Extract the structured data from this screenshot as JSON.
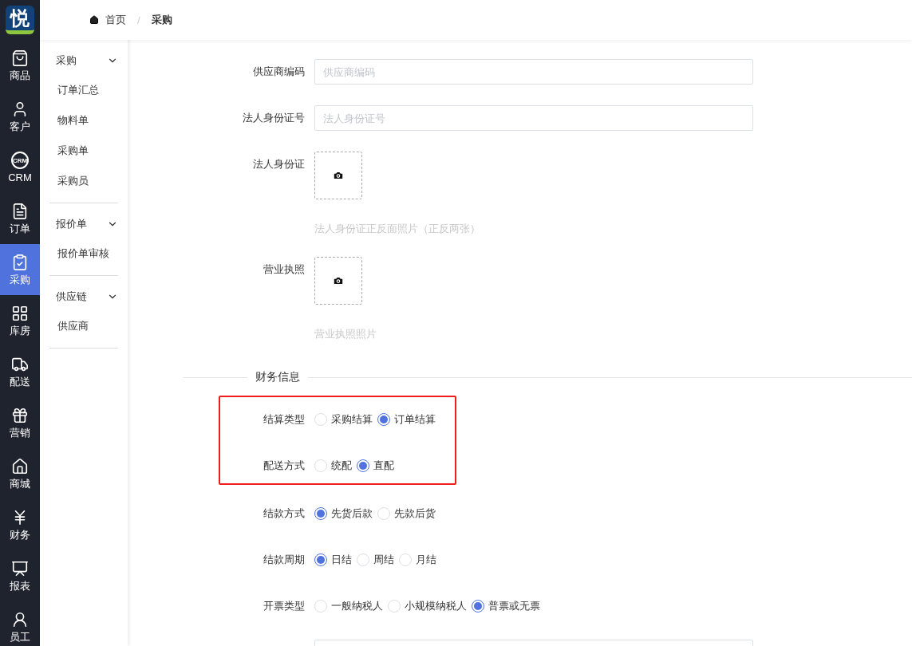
{
  "logo": {
    "text": "悦"
  },
  "rail": [
    {
      "label": "商品",
      "selected": false
    },
    {
      "label": "客户",
      "selected": false
    },
    {
      "label": "CRM",
      "icon_text": "CRM",
      "selected": false
    },
    {
      "label": "订单",
      "selected": false
    },
    {
      "label": "采购",
      "selected": true
    },
    {
      "label": "库房",
      "selected": false
    },
    {
      "label": "配送",
      "selected": false
    },
    {
      "label": "营销",
      "selected": false
    },
    {
      "label": "商城",
      "selected": false
    },
    {
      "label": "财务",
      "selected": false
    },
    {
      "label": "报表",
      "selected": false
    },
    {
      "label": "员工",
      "selected": false
    }
  ],
  "menu": [
    {
      "title": "采购",
      "expanded": true,
      "items": [
        "订单汇总",
        "物料单",
        "采购单",
        "采购员"
      ]
    },
    {
      "title": "报价单",
      "expanded": true,
      "items": [
        "报价单审核"
      ]
    },
    {
      "title": "供应链",
      "expanded": true,
      "items": [
        "供应商"
      ]
    }
  ],
  "breadcrumb": [
    {
      "label": "首页",
      "current": false
    },
    {
      "label": "采购",
      "current": true
    }
  ],
  "breadcrumb_separator": "/",
  "supplier_fields": [
    {
      "kind": "input",
      "label": "供应商编码",
      "placeholder": "供应商编码"
    },
    {
      "kind": "input",
      "label": "法人身份证号",
      "placeholder": "法人身份证号"
    },
    {
      "kind": "upload",
      "label": "法人身份证",
      "hint": "法人身份证正反面照片（正反两张）"
    },
    {
      "kind": "upload",
      "label": "营业执照",
      "hint": "营业执照照片"
    }
  ],
  "finance": {
    "title": "财务信息",
    "groups": [
      {
        "highlighted": true,
        "fields": [
          {
            "label": "结算类型",
            "options": [
              {
                "label": "采购结算",
                "selected": false
              },
              {
                "label": "订单结算",
                "selected": true
              }
            ]
          },
          {
            "label": "配送方式",
            "options": [
              {
                "label": "统配",
                "selected": false
              },
              {
                "label": "直配",
                "selected": true
              }
            ]
          }
        ]
      },
      {
        "highlighted": false,
        "fields": [
          {
            "label": "结款方式",
            "options": [
              {
                "label": "先货后款",
                "selected": true
              },
              {
                "label": "先款后货",
                "selected": false
              }
            ]
          },
          {
            "label": "结款周期",
            "options": [
              {
                "label": "日结",
                "selected": true
              },
              {
                "label": "周结",
                "selected": false
              },
              {
                "label": "月结",
                "selected": false
              }
            ]
          },
          {
            "label": "开票类型",
            "options": [
              {
                "label": "一般纳税人",
                "selected": false
              },
              {
                "label": "小规模纳税人",
                "selected": false
              },
              {
                "label": "普票或无票",
                "selected": true
              }
            ]
          }
        ]
      }
    ]
  }
}
